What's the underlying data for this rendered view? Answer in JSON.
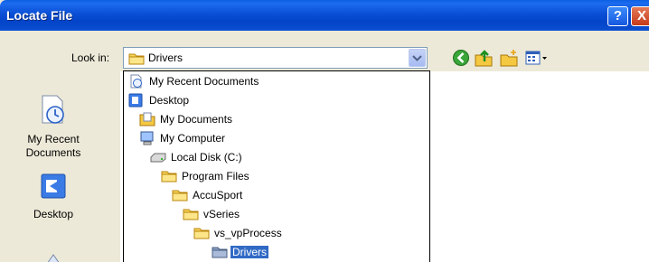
{
  "window": {
    "title": "Locate File",
    "help_glyph": "?",
    "close_glyph": "X"
  },
  "lookin": {
    "label": "Look in:",
    "selected": "Drivers"
  },
  "toolbar": [
    {
      "name": "back-icon"
    },
    {
      "name": "up-folder-icon"
    },
    {
      "name": "new-folder-icon"
    },
    {
      "name": "views-menu-icon"
    }
  ],
  "places": [
    {
      "label_line1": "My Recent",
      "label_line2": "Documents"
    },
    {
      "label_line1": "Desktop"
    }
  ],
  "dropdown": [
    {
      "label": "My Recent Documents",
      "icon": "recent-docs-icon"
    },
    {
      "label": "Desktop",
      "icon": "desktop-icon"
    },
    {
      "label": "My Documents",
      "icon": "my-documents-icon"
    },
    {
      "label": "My Computer",
      "icon": "my-computer-icon"
    },
    {
      "label": "Local Disk (C:)",
      "icon": "disk-icon"
    },
    {
      "label": "Program Files",
      "icon": "folder-icon"
    },
    {
      "label": "AccuSport",
      "icon": "folder-icon"
    },
    {
      "label": "vSeries",
      "icon": "folder-icon"
    },
    {
      "label": "vs_vpProcess",
      "icon": "folder-icon"
    },
    {
      "label": "Drivers",
      "icon": "open-folder-icon",
      "selected": true
    }
  ],
  "colors": {
    "titlebar": "#0a4fd6",
    "selection": "#316ac5",
    "dialog": "#ECE9D8"
  }
}
